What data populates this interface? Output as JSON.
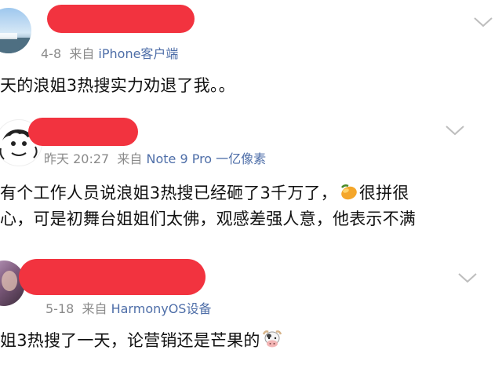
{
  "posts": [
    {
      "date": "4-8",
      "source_prefix": "来自",
      "source": "iPhone客户端",
      "lines": [
        "天的浪姐3热搜实力劝退了我。。"
      ]
    },
    {
      "date": "昨天 20:27",
      "source_prefix": "来自",
      "source": "Note 9 Pro 一亿像素",
      "line1_before_emoji": "有个工作人员说浪姐3热搜已经砸了3千万了，",
      "emoji1": "mango-emoji",
      "line1_after_emoji": "很拼很",
      "line2": "心，可是初舞台姐姐们太佛，观感差强人意，他表示不满"
    },
    {
      "date": "5-18",
      "source_prefix": "来自",
      "source": "HarmonyOS设备",
      "line_before_emoji": "姐3热搜了一天，论营销还是芒果的",
      "emoji": "cow-emoji"
    }
  ],
  "colors": {
    "redaction": "#f2333f",
    "source_link": "#4e6ea8",
    "meta_text": "#8a8a8a"
  }
}
